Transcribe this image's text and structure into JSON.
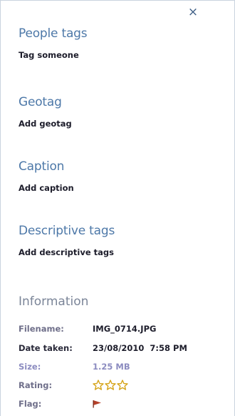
{
  "pane": {
    "close_icon": "×",
    "sections": [
      {
        "heading": "People tags",
        "link": "Tag someone"
      },
      {
        "heading": "Geotag",
        "link": "Add geotag"
      },
      {
        "heading": "Caption",
        "link": "Add caption"
      },
      {
        "heading": "Descriptive tags",
        "link": "Add descriptive tags"
      }
    ]
  },
  "information": {
    "heading": "Information",
    "filename_label": "Filename:",
    "filename_value": "IMG_0714.JPG",
    "date_label": "Date taken:",
    "date_value": "23/08/2010  7:58 PM",
    "size_label": "Size:",
    "size_value": "1.25 MB",
    "rating_label": "Rating:",
    "rating_value": 0,
    "rating_max": 3,
    "flag_label": "Flag:",
    "flag_icon": "flag-icon"
  },
  "colors": {
    "heading": "#4d78a8",
    "star_outline": "#d6a51c",
    "flag": "#b5412a"
  }
}
